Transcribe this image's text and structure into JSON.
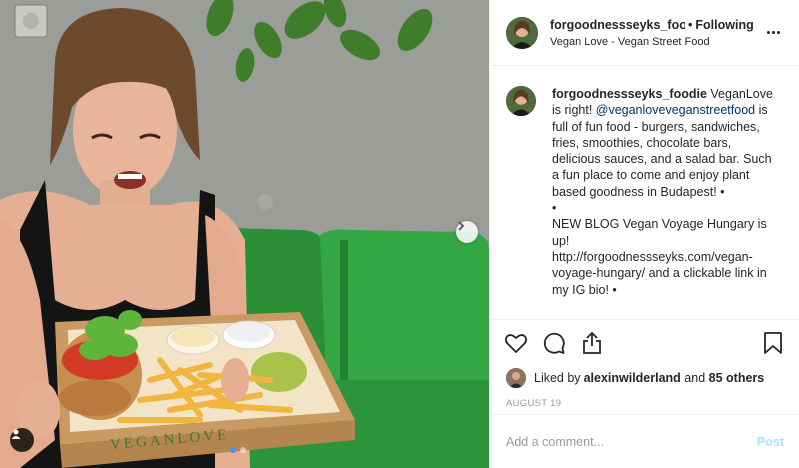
{
  "post": {
    "username": "forgoodnessseyks_foodie",
    "username_truncated": "forgoodnessseyks_fooc",
    "follow_status": "Following",
    "separator": "•",
    "location": "Vegan Love - Vegan Street Food",
    "tray_brand": "VEGANLOVE"
  },
  "caption": {
    "username": "forgoodnessseyks_foodie",
    "text_before": "VeganLove is right! ",
    "mention": "@veganloveveganstreetfood",
    "text_after": " is full of fun food - burgers, sandwiches, fries, smoothies, chocolate bars, delicious sauces, and a salad bar. Such a fun place to come and enjoy plant based goodness in Budapest! •",
    "bullet": "•",
    "blog_line": "NEW BLOG Vegan Voyage Hungary is up!",
    "blog_link": "http://forgoodnessseyks.com/vegan-voyage-hungary/ and a clickable link in my IG bio! •"
  },
  "likes": {
    "prefix": "Liked by ",
    "user": "alexinwilderland",
    "middle": " and ",
    "others": "85 others"
  },
  "date": "AUGUST 19",
  "comment_input": {
    "placeholder": "Add a comment..."
  },
  "post_button": "Post",
  "icons": {
    "like": "heart-icon",
    "comment": "speech-bubble-icon",
    "share": "share-icon",
    "save": "bookmark-icon",
    "more": "more-options-icon",
    "next": "chevron-right-icon",
    "tag": "user-tag-icon"
  },
  "colors": {
    "link": "#003569",
    "post_disabled": "#b2dffc",
    "carousel_active": "#3897f0",
    "sofa": "#2e9b3e",
    "wall": "#8e918e"
  }
}
